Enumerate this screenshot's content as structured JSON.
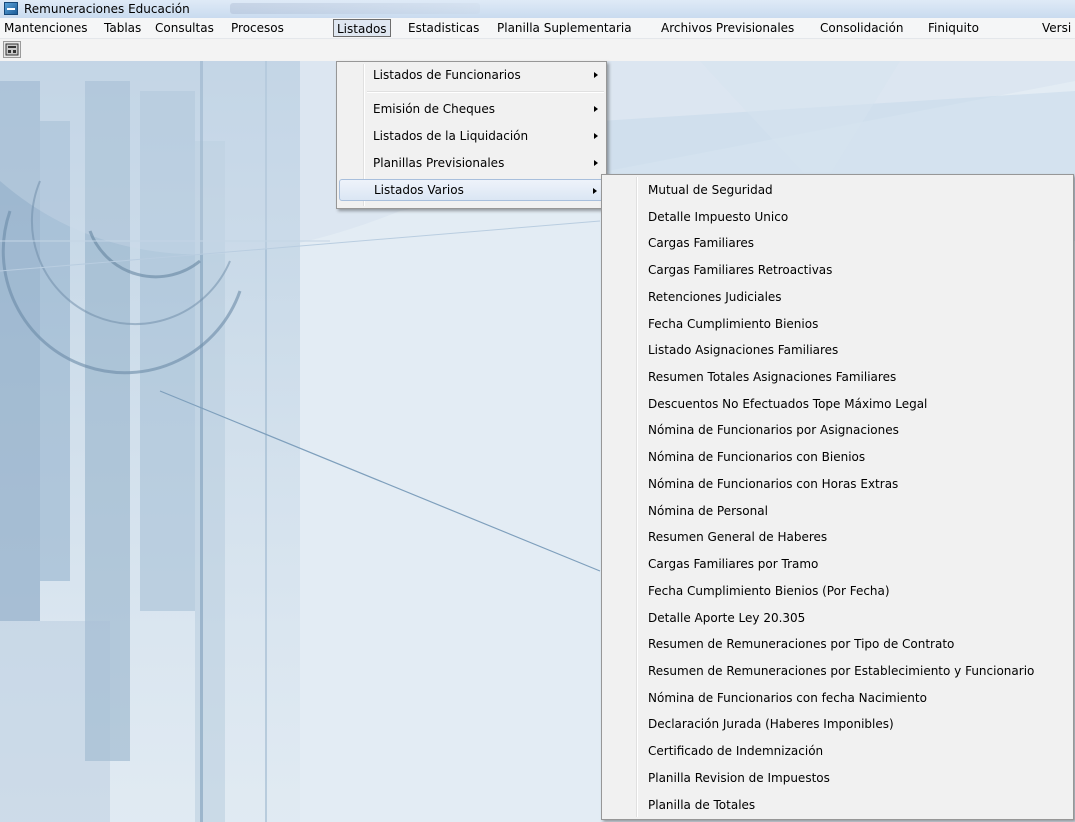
{
  "window": {
    "title": "Remuneraciones Educación"
  },
  "menubar": {
    "items": [
      {
        "label": "Mantenciones"
      },
      {
        "label": "Tablas"
      },
      {
        "label": "Consultas"
      },
      {
        "label": "Procesos"
      },
      {
        "label": "Listados"
      },
      {
        "label": "Estadisticas"
      },
      {
        "label": "Planilla Suplementaria"
      },
      {
        "label": "Archivos Previsionales"
      },
      {
        "label": "Consolidación"
      },
      {
        "label": "Finiquito"
      },
      {
        "label": "Versi"
      }
    ]
  },
  "listados_menu": {
    "items": [
      {
        "label": "Listados de Funcionarios"
      },
      {
        "label": "Emisión de Cheques"
      },
      {
        "label": "Listados de la Liquidación"
      },
      {
        "label": "Planillas Previsionales"
      },
      {
        "label": "Listados Varios"
      }
    ]
  },
  "listados_varios_menu": {
    "items": [
      {
        "label": "Mutual de Seguridad"
      },
      {
        "label": "Detalle Impuesto Unico"
      },
      {
        "label": "Cargas Familiares"
      },
      {
        "label": "Cargas Familiares Retroactivas"
      },
      {
        "label": "Retenciones Judiciales"
      },
      {
        "label": "Fecha Cumplimiento Bienios"
      },
      {
        "label": "Listado Asignaciones Familiares"
      },
      {
        "label": "Resumen Totales Asignaciones Familiares"
      },
      {
        "label": "Descuentos No Efectuados Tope Máximo Legal"
      },
      {
        "label": "Nómina de Funcionarios por Asignaciones"
      },
      {
        "label": "Nómina de Funcionarios con Bienios"
      },
      {
        "label": "Nómina de Funcionarios con Horas Extras"
      },
      {
        "label": "Nómina de Personal"
      },
      {
        "label": "Resumen General de Haberes"
      },
      {
        "label": "Cargas Familiares por Tramo"
      },
      {
        "label": "Fecha Cumplimiento Bienios (Por Fecha)"
      },
      {
        "label": "Detalle Aporte Ley 20.305"
      },
      {
        "label": "Resumen de Remuneraciones por Tipo de Contrato"
      },
      {
        "label": "Resumen de Remuneraciones por Establecimiento y Funcionario"
      },
      {
        "label": "Nómina de Funcionarios con fecha Nacimiento"
      },
      {
        "label": "Declaración Jurada (Haberes Imponibles)"
      },
      {
        "label": "Certificado de Indemnización"
      },
      {
        "label": "Planilla Revision de Impuestos"
      },
      {
        "label": "Planilla de Totales"
      }
    ]
  },
  "toolbar": {
    "icon": "exit-icon"
  }
}
